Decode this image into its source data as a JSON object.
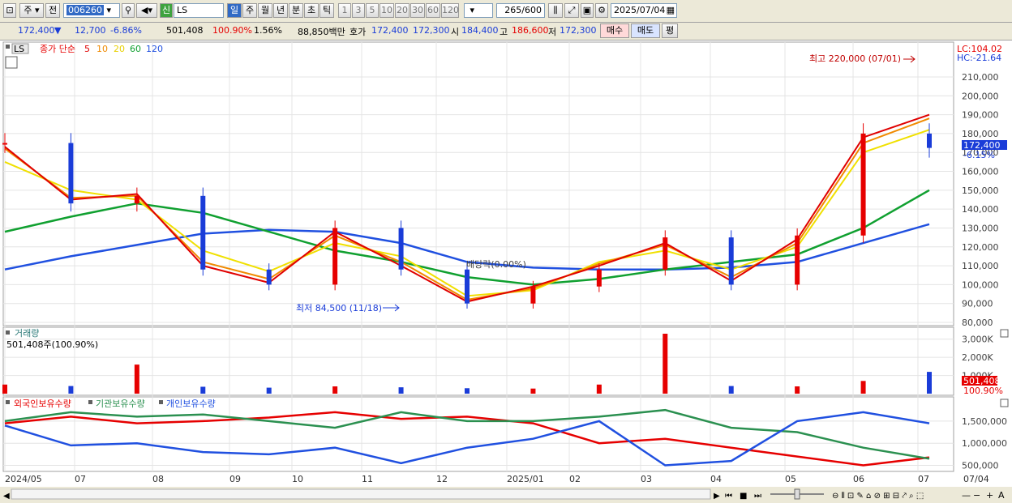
{
  "toolbar": {
    "period_short": "주",
    "all_label": "전",
    "code": "006260",
    "new_badge": "신",
    "name": "LS",
    "intervals": [
      "일",
      "주",
      "월",
      "년",
      "분",
      "초",
      "틱"
    ],
    "minute_steps": [
      "1",
      "3",
      "5",
      "10",
      "20",
      "30",
      "60",
      "120"
    ],
    "count": "265",
    "total": "/600",
    "date": "2025/07/04"
  },
  "quote": {
    "price": "172,400",
    "arrow": "▼",
    "change": "12,700",
    "change_pct": "-6.86%",
    "volume": "501,408",
    "volume_ratio": "100.90%",
    "turnover": "1.56%",
    "amount": "88,850백만",
    "ask_label": "호가",
    "ask": "172,400",
    "bid": "172,300",
    "open_label": "시",
    "open": "184,400",
    "high_label": "고",
    "high": "186,600",
    "low_label": "저",
    "low": "172,300",
    "buy": "매수",
    "sell": "매도",
    "avg": "평"
  },
  "colors": {
    "up": "#e60000",
    "down": "#1a3cd8",
    "ma5": "#e00000",
    "ma10": "#f08a00",
    "ma20": "#f0e000",
    "ma60": "#10a030",
    "ma120": "#2050e0",
    "foreign": "#e60000",
    "inst": "#2b9050",
    "indiv": "#2050e0"
  },
  "price_panel": {
    "legend_name": "LS",
    "legend_type": "종가 단순",
    "ma_periods": [
      "5",
      "10",
      "20",
      "60",
      "120"
    ],
    "lc": "LC:104.02",
    "hc": "HC:-21.64",
    "current_price": "172,400",
    "current_pct": "-6.15%",
    "max_label": "최고 220,000 (07/01)",
    "min_label": "최저 84,500 (11/18)",
    "dividend_label": "배당락(0.00%)"
  },
  "volume_panel": {
    "title": "거래량",
    "value": "501,408주(100.90%)",
    "current": "501,408",
    "current_pct": "100.90%"
  },
  "holding_panel": {
    "legend": [
      "외국인보유수량",
      "기관보유수량",
      "개인보유수량"
    ]
  },
  "chart_data": [
    {
      "type": "candlestick",
      "title": "LS",
      "ylim": [
        80000,
        225000
      ],
      "y_ticks": [
        "210,000",
        "200,000",
        "190,000",
        "180,000",
        "170,000",
        "160,000",
        "150,000",
        "140,000",
        "130,000",
        "120,000",
        "110,000",
        "100,000",
        "90,000",
        "80,000"
      ],
      "x_ticks": [
        "2024/05",
        "07",
        "08",
        "09",
        "10",
        "11",
        "12",
        "2025/01",
        "02",
        "03",
        "04",
        "05",
        "06",
        "07",
        "07/04"
      ],
      "dates": [
        "2024/05",
        "2024/06",
        "2024/07",
        "2024/08",
        "2024/09",
        "2024/10",
        "2024/11",
        "2024/12",
        "2025/01",
        "2025/02",
        "2025/03",
        "2025/04",
        "2025/05",
        "2025/06",
        "2025/07"
      ],
      "series": [
        {
          "name": "종가",
          "values": [
            175000,
            143000,
            147000,
            108000,
            100000,
            130000,
            108000,
            90000,
            99000,
            108000,
            125000,
            100000,
            126000,
            180000,
            172400
          ]
        },
        {
          "name": "5",
          "values": [
            173000,
            145000,
            148000,
            110000,
            101000,
            128000,
            110000,
            91000,
            99000,
            110000,
            122000,
            102000,
            124000,
            178000,
            190000
          ]
        },
        {
          "name": "10",
          "values": [
            172000,
            146000,
            147000,
            112000,
            103000,
            126000,
            112000,
            92000,
            98000,
            111000,
            121000,
            104000,
            122000,
            175000,
            188000
          ]
        },
        {
          "name": "20",
          "values": [
            165000,
            150000,
            145000,
            118000,
            107000,
            122000,
            115000,
            94000,
            97000,
            112000,
            118000,
            108000,
            120000,
            170000,
            182000
          ]
        },
        {
          "name": "60",
          "values": [
            128000,
            136000,
            143000,
            138000,
            128000,
            118000,
            112000,
            104000,
            100000,
            103000,
            108000,
            112000,
            116000,
            130000,
            150000
          ]
        },
        {
          "name": "120",
          "values": [
            108000,
            115000,
            121000,
            127000,
            129000,
            128000,
            122000,
            112000,
            109000,
            108000,
            108000,
            109000,
            112000,
            122000,
            132000
          ]
        }
      ]
    },
    {
      "type": "bar",
      "title": "거래량",
      "ylim": [
        0,
        3300000
      ],
      "y_ticks": [
        "3,000K",
        "2,000K",
        "1,000K"
      ],
      "categories": [
        "2024/05",
        "2024/06",
        "2024/07",
        "2024/08",
        "2024/09",
        "2024/10",
        "2024/11",
        "2024/12",
        "2025/01",
        "2025/02",
        "2025/03",
        "2025/04",
        "2025/05",
        "2025/06",
        "2025/07"
      ],
      "values": [
        500000,
        420000,
        1600000,
        380000,
        330000,
        400000,
        350000,
        300000,
        280000,
        500000,
        3300000,
        420000,
        400000,
        700000,
        1200000
      ]
    },
    {
      "type": "line",
      "ylim": [
        400000,
        1900000
      ],
      "y_ticks": [
        "1,500,000",
        "1,000,000",
        "500,000"
      ],
      "x": [
        "2024/05",
        "2024/06",
        "2024/07",
        "2024/08",
        "2024/09",
        "2024/10",
        "2024/11",
        "2024/12",
        "2025/01",
        "2025/02",
        "2025/03",
        "2025/04",
        "2025/05",
        "2025/06",
        "2025/07"
      ],
      "series": [
        {
          "name": "외국인보유수량",
          "values": [
            1450000,
            1600000,
            1450000,
            1500000,
            1580000,
            1700000,
            1550000,
            1600000,
            1450000,
            1000000,
            1100000,
            900000,
            700000,
            500000,
            680000
          ]
        },
        {
          "name": "기관보유수량",
          "values": [
            1500000,
            1700000,
            1600000,
            1650000,
            1500000,
            1350000,
            1700000,
            1500000,
            1500000,
            1600000,
            1750000,
            1350000,
            1250000,
            900000,
            650000
          ]
        },
        {
          "name": "개인보유수량",
          "values": [
            1400000,
            950000,
            1000000,
            800000,
            750000,
            900000,
            550000,
            900000,
            1100000,
            1500000,
            500000,
            600000,
            1500000,
            1700000,
            1450000
          ]
        }
      ]
    }
  ]
}
